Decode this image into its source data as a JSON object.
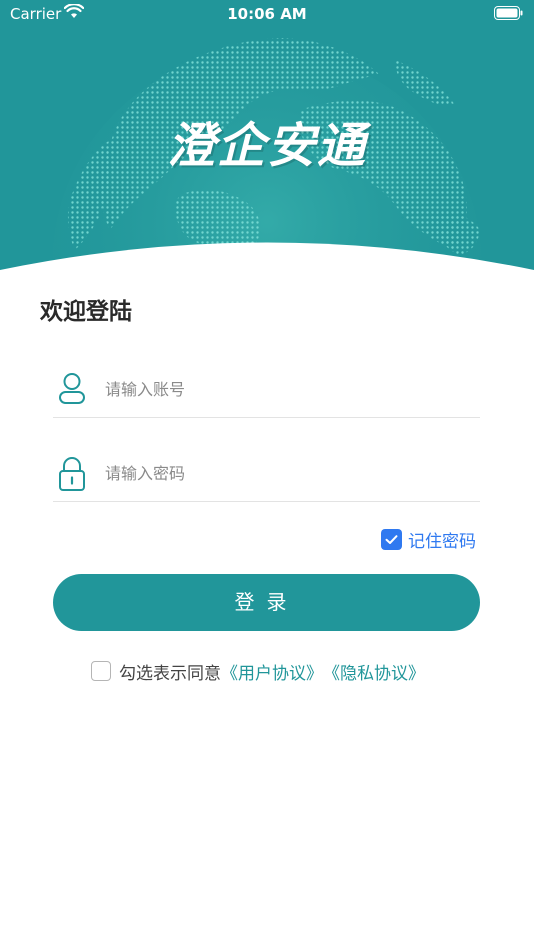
{
  "status_bar": {
    "carrier": "Carrier",
    "time": "10:06 AM"
  },
  "header": {
    "app_name": "澄企安通",
    "globe_icon": "globe-icon"
  },
  "welcome_title": "欢迎登陆",
  "account_field": {
    "placeholder": "请输入账号",
    "value": "",
    "icon": "user-icon"
  },
  "password_field": {
    "placeholder": "请输入密码",
    "value": "",
    "icon": "lock-icon"
  },
  "remember": {
    "label": "记住密码",
    "checked": true
  },
  "login_button": {
    "label": "登录"
  },
  "agreement": {
    "checked": false,
    "text": "勾选表示同意",
    "user_agreement": "《用户协议》",
    "privacy_agreement": "《隐私协议》"
  },
  "colors": {
    "primary": "#21969a",
    "accent_blue": "#2f79f0",
    "text_dark": "#2a2a2a",
    "placeholder": "#8a8a8a"
  }
}
